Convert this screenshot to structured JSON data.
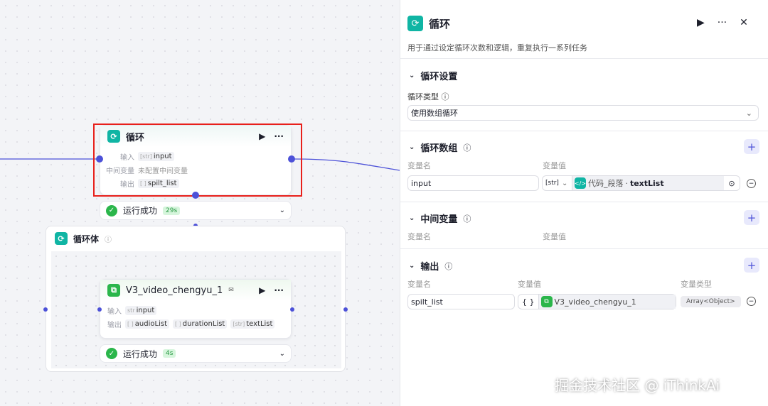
{
  "canvas": {
    "loop_node": {
      "title": "循环",
      "input_label": "输入",
      "input_value": "input",
      "mid_label": "中间变量",
      "mid_value": "未配置中间变量",
      "output_label": "输出",
      "output_value": "spilt_list",
      "status": "运行成功",
      "time": "29s"
    },
    "loop_body": {
      "title": "循环体"
    },
    "sub_node": {
      "title": "V3_video_chengyu_1",
      "input_label": "输入",
      "input_value": "input",
      "input_type": "str",
      "output_label": "输出",
      "outputs": [
        "audioList",
        "durationList",
        "textList"
      ],
      "status": "运行成功",
      "time": "4s"
    }
  },
  "panel": {
    "title": "循环",
    "description": "用于通过设定循环次数和逻辑，重复执行一系列任务",
    "settings": {
      "title": "循环设置",
      "type_label": "循环类型",
      "type_value": "使用数组循环"
    },
    "array": {
      "title": "循环数组",
      "name_header": "变量名",
      "value_header": "变量值",
      "name": "input",
      "type": "[str]",
      "source_node": "代码_段落",
      "source_field": "textList"
    },
    "mid": {
      "title": "中间变量",
      "name_header": "变量名",
      "value_header": "变量值"
    },
    "output": {
      "title": "输出",
      "name_header": "变量名",
      "value_header": "变量值",
      "type_header": "变量类型",
      "name": "spilt_list",
      "brace": "{ }",
      "value": "V3_video_chengyu_1",
      "type": "Array<Object>"
    }
  },
  "watermark": "掘金技术社区 @ iThinkAi",
  "colors": {
    "accent": "#4c51d8",
    "teal": "#10b5a4",
    "success": "#2bb64b",
    "highlight": "#e8201b"
  }
}
